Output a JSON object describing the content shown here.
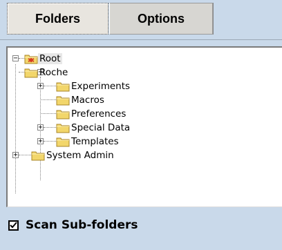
{
  "tabs": {
    "folders_label": "Folders",
    "options_label": "Options"
  },
  "tree": {
    "root": "Root",
    "roche": "Roche",
    "experiments": "Experiments",
    "macros": "Macros",
    "preferences": "Preferences",
    "special_data": "Special Data",
    "templates": "Templates",
    "system_admin": "System Admin"
  },
  "scan": {
    "label": "Scan Sub-folders",
    "checked": true
  },
  "colors": {
    "background": "#c9d9ea",
    "folder_yellow": "#f2d66b",
    "root_icon_red": "#d63a1f"
  }
}
